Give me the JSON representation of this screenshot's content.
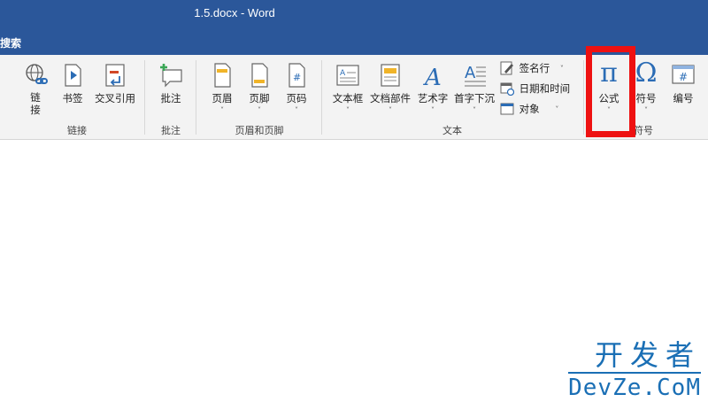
{
  "window": {
    "title": "1.5.docx  -  Word"
  },
  "menubar": {
    "search_label": "搜索"
  },
  "ribbon": {
    "groups": {
      "links": {
        "label": "链接",
        "buttons": {
          "link": "链\n接",
          "bookmark": "书签",
          "cross_reference": "交叉引用"
        }
      },
      "comments": {
        "label": "批注",
        "buttons": {
          "comment": "批注"
        }
      },
      "header_footer": {
        "label": "页眉和页脚",
        "buttons": {
          "header": "页眉",
          "footer": "页脚",
          "page_number": "页码"
        }
      },
      "text": {
        "label": "文本",
        "buttons": {
          "text_box": "文本框",
          "quick_parts": "文档部件",
          "wordart": "艺术字",
          "drop_cap": "首字下沉",
          "signature_line": "签名行",
          "date_time": "日期和时间",
          "object": "对象"
        }
      },
      "symbols": {
        "label": "符号",
        "buttons": {
          "equation": "公式",
          "symbol": "符号",
          "numbering": "编号"
        },
        "icons": {
          "equation": "π",
          "symbol": "Ω",
          "numbering": "#"
        }
      }
    },
    "caret": "˅"
  },
  "colors": {
    "title_bar": "#2b579a",
    "ribbon": "#f3f3f3",
    "highlight": "#ee1111",
    "watermark": "#1a6fb5"
  },
  "watermark": {
    "cn": "开发者",
    "en": "DevZe.CoM"
  }
}
